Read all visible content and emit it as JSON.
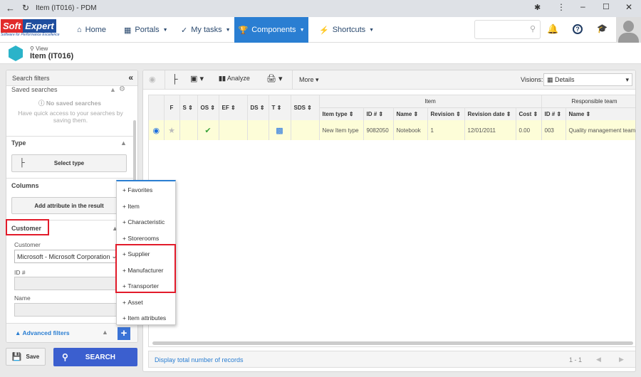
{
  "window": {
    "title": "Item (IT016) - PDM"
  },
  "brand": {
    "logo_text": "SoftExpert",
    "tagline": "Software for Performance Excellence",
    "accent": "#2a7ed2"
  },
  "nav": {
    "home": "Home",
    "portals": "Portals",
    "my_tasks": "My tasks",
    "components": "Components",
    "shortcuts": "Shortcuts",
    "search_placeholder": ""
  },
  "header": {
    "mode": "View",
    "title": "Item (IT016)"
  },
  "filters": {
    "title": "Search filters",
    "saved_searches": "Saved searches",
    "no_saved": "No saved searches",
    "no_saved_hint": "Have quick access to your searches by saving them.",
    "type_label": "Type",
    "select_type": "Select type",
    "columns_label": "Columns",
    "add_attribute": "Add attribute in the result",
    "customer_section": "Customer",
    "customer_label": "Customer",
    "customer_value": "Microsoft - Microsoft Corporation",
    "id_label": "ID #",
    "id_value": "",
    "name_label": "Name",
    "name_value": "",
    "advanced": "Advanced filters",
    "save": "Save",
    "search": "SEARCH"
  },
  "menu": {
    "items": [
      "Favorites",
      "Item",
      "Characteristic",
      "Storerooms",
      "Supplier",
      "Manufacturer",
      "Transporter",
      "Asset",
      "Item attributes"
    ]
  },
  "toolbar": {
    "analyze": "Analyze",
    "more": "More",
    "visions_label": "Visions:",
    "visions_value": "Details"
  },
  "grid": {
    "group_item": "Item",
    "group_team": "Responsible team",
    "columns": [
      "F",
      "S",
      "OS",
      "EF",
      "DS",
      "T",
      "SDS",
      "Item type",
      "ID #",
      "Name",
      "Revision",
      "Revision date",
      "Cost",
      "ID #",
      "Name"
    ],
    "rows": [
      {
        "item_type": "New Item type",
        "id": "9082050",
        "name": "Notebook",
        "revision": "1",
        "revision_date": "12/01/2011",
        "cost": "0.00",
        "team_id": "003",
        "team_name": "Quality management team"
      }
    ],
    "footer_link": "Display total number of records",
    "pagination": "1 - 1"
  }
}
